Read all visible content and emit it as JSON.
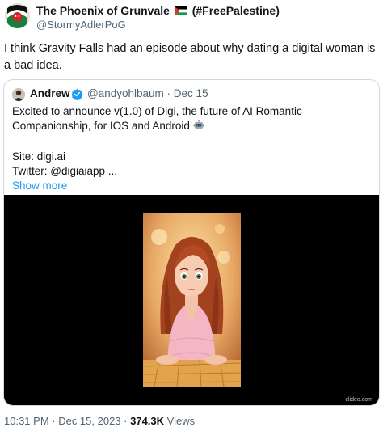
{
  "tweet": {
    "author_name": "The Phoenix of Grunvale",
    "author_suffix": "(#FreePalestine)",
    "author_handle": "@StormyAdlerPoG",
    "text": "I think Gravity Falls had an episode about why dating a digital woman is a bad idea."
  },
  "quote": {
    "author_name": "Andrew",
    "author_handle": "@andyohlbaum",
    "separator": "·",
    "date": "Dec 15",
    "line1": "Excited to announce v(1.0) of Digi, the future of AI Romantic Companionship, for IOS and Android",
    "site": "Site: digi.ai",
    "twitter": "Twitter: @digiaiapp ...",
    "show_more": "Show more",
    "video_watermark": "clideo.com"
  },
  "meta": {
    "timestamp": "10:31 PM · Dec 15, 2023 ·",
    "views_count": "374.3K",
    "views_label": "Views"
  },
  "colors": {
    "link": "#1d9bf0",
    "muted": "#536471",
    "verified": "#1d9bf0"
  }
}
